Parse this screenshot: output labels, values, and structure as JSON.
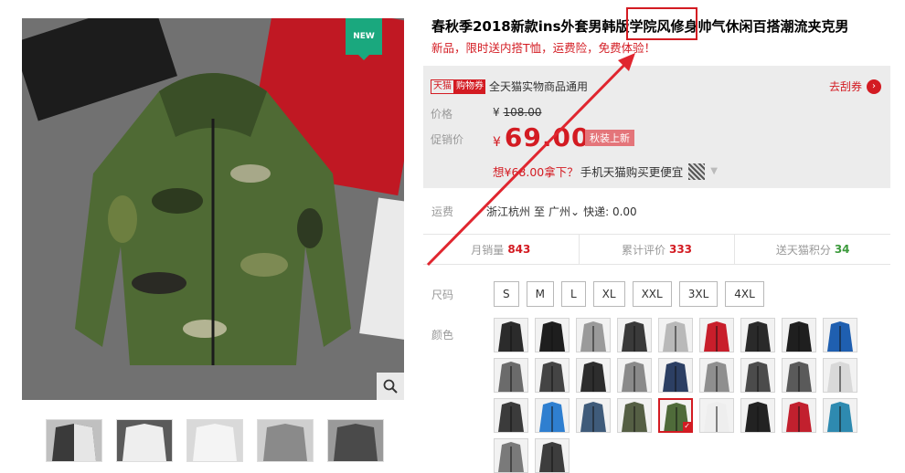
{
  "product": {
    "title": "春秋季2018新款ins外套男韩版学院风修身帅气休闲百搭潮流夹克男",
    "subtitle": "新品，限时送内搭T恤，运费险，免费体验！"
  },
  "badge": {
    "new_label": "NEW"
  },
  "coupon": {
    "tmall_tag": "天猫",
    "shopping_tag": "购物券",
    "text": "全天猫实物商品通用",
    "get_label": "去刮券"
  },
  "price": {
    "orig_label": "价格",
    "orig_currency": "¥",
    "orig_value": "108.00",
    "promo_label": "促销价",
    "promo_currency": "¥",
    "promo_value": "69.00",
    "promo_tag": "秋装上新",
    "mobile_pre": "想",
    "mobile_price": "¥68.00拿下？",
    "mobile_tip": "手机天猫购买更便宜"
  },
  "shipping": {
    "label": "运费",
    "from": "浙江杭州",
    "to_word": "至",
    "city": "广州",
    "express": "快递: 0.00"
  },
  "stats": {
    "monthly_label": "月销量",
    "monthly_value": "843",
    "reviews_label": "累计评价",
    "reviews_value": "333",
    "points_label": "送天猫积分",
    "points_value": "34"
  },
  "attributes": {
    "size_label": "尺码",
    "color_label": "颜色",
    "sizes": [
      "S",
      "M",
      "L",
      "XL",
      "XXL",
      "3XL",
      "4XL"
    ]
  },
  "colors": {
    "swatches": [
      "#2b2b2b",
      "#1e1e1e",
      "#9a9a9a",
      "#3a3a3a",
      "#b9b9b9",
      "#c81e2b",
      "#2a2a2a",
      "#1f1f1f",
      "#1f5fb0",
      "#6b6b6b",
      "#444444",
      "#2d2d2d",
      "#8a8a8a",
      "#2c3f63",
      "#8f8f8f",
      "#4b4b4b",
      "#5a5a5a",
      "#d9d9d9",
      "#3b3b3b",
      "#2f7fd0",
      "#3f5b7a",
      "#555f44",
      "#4f6b3a",
      "#eeeeee",
      "#222222",
      "#c2202e",
      "#2e8ab0",
      "#7a7a7a",
      "#3d3d3d"
    ],
    "selected_index": 22
  }
}
